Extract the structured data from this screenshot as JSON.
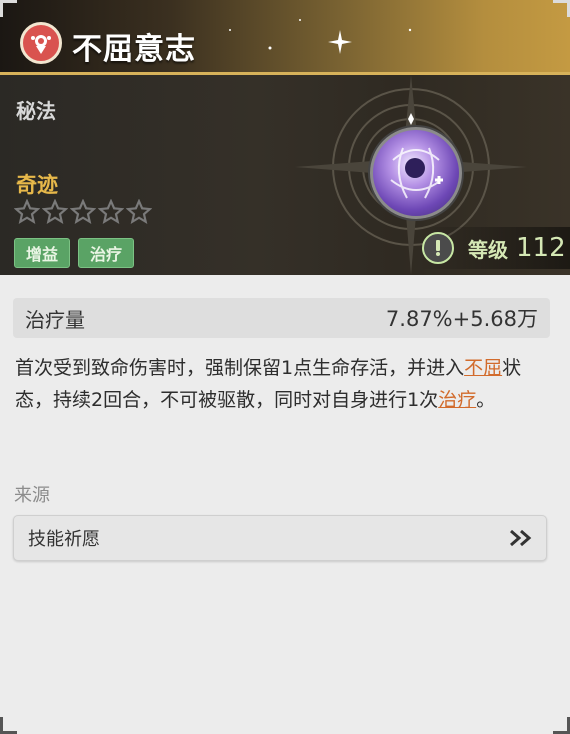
{
  "title": "不屈意志",
  "category": "秘法",
  "rarity": "奇迹",
  "star_rating": {
    "filled": 0,
    "total": 5
  },
  "tags": [
    "增益",
    "治疗"
  ],
  "level": {
    "label": "等级",
    "value": "112"
  },
  "stat": {
    "label": "治疗量",
    "value": "7.87%+5.68万"
  },
  "description": {
    "part1": "首次受到致命伤害时，强制保留1点生命存活，并进入",
    "kw1": "不屈",
    "part2": "状态，持续2回合，不可被驱散，同时对自身进行1次",
    "kw2": "治疗",
    "part3": "。"
  },
  "source": {
    "label": "来源",
    "button": "技能祈愿"
  },
  "colors": {
    "accent_gold": "#e7b84a",
    "tag_green": "#5aa365",
    "keyword_orange": "#d26b2c"
  },
  "icons": [
    "medal-icon",
    "skill-orb-icon",
    "star-icon",
    "exclamation-icon",
    "double-chevron-right-icon"
  ]
}
